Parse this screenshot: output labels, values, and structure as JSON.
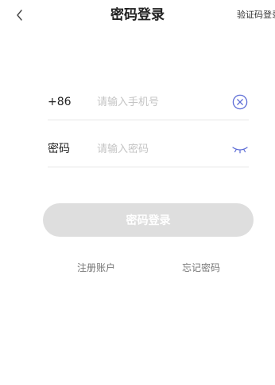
{
  "header": {
    "title": "密码登录",
    "switch_link": "验证码登录",
    "back_icon": "chevron-left-icon"
  },
  "form": {
    "phone": {
      "prefix": "+86",
      "value": "",
      "placeholder": "请输入手机号",
      "clear_icon": "clear-circle-icon"
    },
    "password": {
      "label": "密码",
      "value": "",
      "placeholder": "请输入密码",
      "visibility_icon": "eye-closed-icon"
    }
  },
  "login_button": {
    "label": "密码登录",
    "state": "disabled"
  },
  "footer": {
    "register_label": "注册账户",
    "forgot_label": "忘记密码"
  },
  "colors": {
    "accent_icon": "#5b6bd6",
    "button_disabled_bg": "#dedede",
    "placeholder": "#c4c4c4"
  }
}
